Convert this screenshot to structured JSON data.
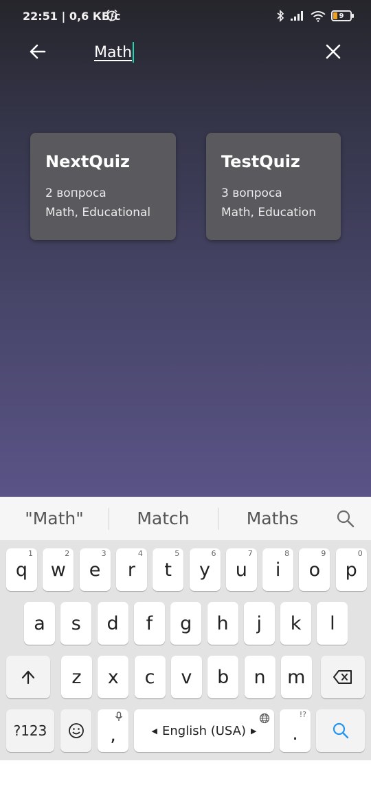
{
  "status_bar": {
    "time": "22:51",
    "net_speed": "| 0,6 КБ/с",
    "battery_level": "9",
    "icons": [
      "alarm-icon",
      "bluetooth-icon",
      "signal-icon",
      "wifi-icon",
      "battery-icon"
    ]
  },
  "top_bar": {
    "back_icon": "arrow-left-icon",
    "query": "Math",
    "clear_icon": "close-icon"
  },
  "results": [
    {
      "title": "NextQuiz",
      "questions": "2 вопроса",
      "tags": "Math, Educational"
    },
    {
      "title": "TestQuiz",
      "questions": "3 вопроса",
      "tags": "Math, Education"
    }
  ],
  "keyboard": {
    "suggestions": [
      "\"Math\"",
      "Match",
      "Maths"
    ],
    "suggestion_search_icon": "search-icon",
    "row1": [
      {
        "k": "q",
        "h": "1"
      },
      {
        "k": "w",
        "h": "2"
      },
      {
        "k": "e",
        "h": "3"
      },
      {
        "k": "r",
        "h": "4"
      },
      {
        "k": "t",
        "h": "5"
      },
      {
        "k": "y",
        "h": "6"
      },
      {
        "k": "u",
        "h": "7"
      },
      {
        "k": "i",
        "h": "8"
      },
      {
        "k": "o",
        "h": "9"
      },
      {
        "k": "p",
        "h": "0"
      }
    ],
    "row2": [
      "a",
      "s",
      "d",
      "f",
      "g",
      "h",
      "j",
      "k",
      "l"
    ],
    "row3": [
      "z",
      "x",
      "c",
      "v",
      "b",
      "n",
      "m"
    ],
    "shift_icon": "shift-icon",
    "backspace_icon": "backspace-icon",
    "symbols_label": "?123",
    "emoji_icon": "emoji-icon",
    "comma_label": ",",
    "mic_icon": "mic-icon",
    "space_label": "English (USA)",
    "globe_icon": "globe-icon",
    "period_label": ".",
    "period_hint": "!?",
    "action_icon": "search-icon"
  },
  "colors": {
    "accent": "#1ed6b0",
    "card": "#5a5a5e",
    "action_key_icon": "#2196f3"
  }
}
